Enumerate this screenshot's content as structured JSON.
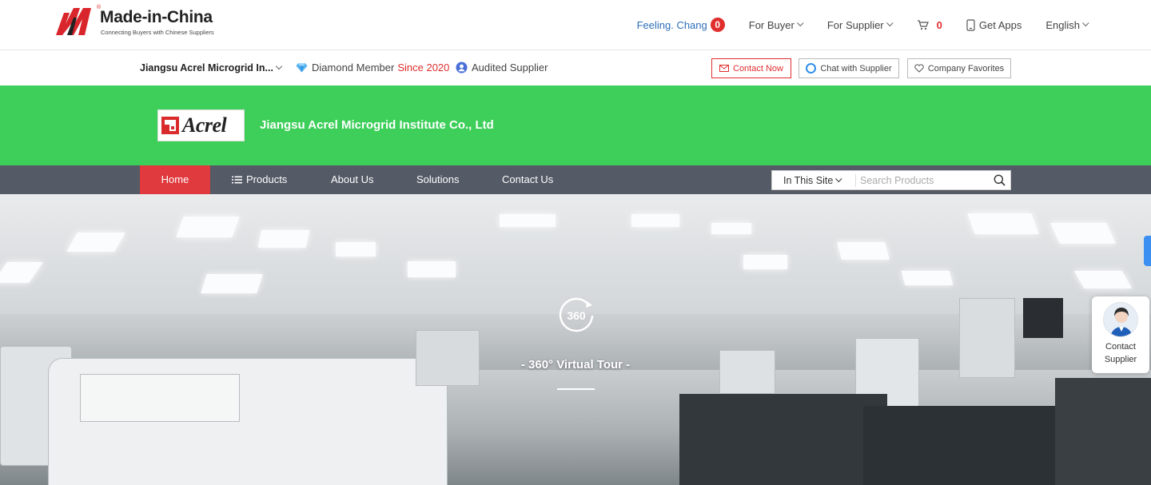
{
  "header": {
    "logo_text": "Made-in-China",
    "logo_tagline": "Connecting Buyers with Chinese Suppliers",
    "user_name": "Feeling. Chang",
    "message_count": "0",
    "for_buyer": "For Buyer",
    "for_supplier": "For Supplier",
    "cart_count": "0",
    "get_apps": "Get Apps",
    "language": "English"
  },
  "supplier_bar": {
    "company_short": "Jiangsu Acrel Microgrid In...",
    "membership": "Diamond Member",
    "since": "Since 2020",
    "audited": "Audited Supplier",
    "contact_now": "Contact Now",
    "chat": "Chat with Supplier",
    "favorites": "Company Favorites"
  },
  "brand": {
    "logo_word": "Acrel",
    "company_name": "Jiangsu Acrel Microgrid Institute Co., Ltd"
  },
  "nav": {
    "home": "Home",
    "products": "Products",
    "about": "About Us",
    "solutions": "Solutions",
    "contact": "Contact Us",
    "search_scope": "In This Site",
    "search_placeholder": "Search Products"
  },
  "hero": {
    "tour_icon_text": "360",
    "tour_label": "- 360° Virtual Tour -"
  },
  "contact_widget": {
    "line1": "Contact",
    "line2": "Supplier"
  },
  "colors": {
    "brand_green": "#3ecf5a",
    "nav_bg": "#545a66",
    "accent_red": "#e0393e",
    "link_blue": "#2f6fb8"
  }
}
